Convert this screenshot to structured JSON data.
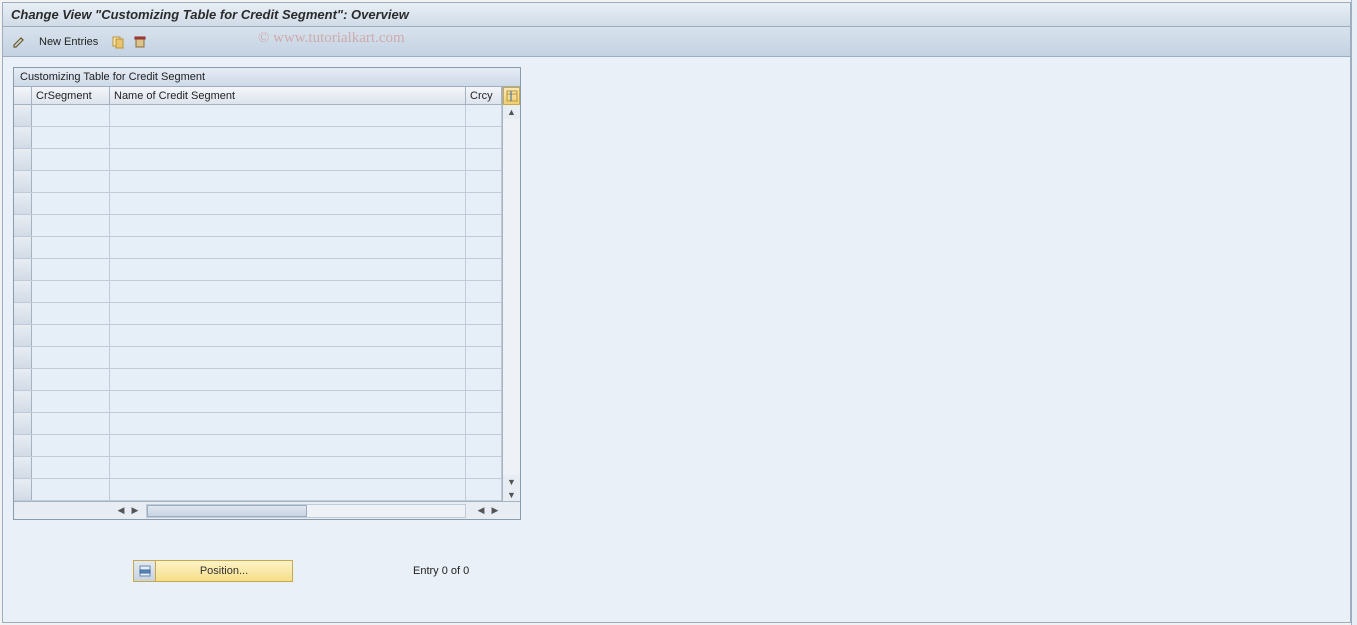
{
  "header": {
    "title": "Change View \"Customizing Table for Credit Segment\": Overview"
  },
  "toolbar": {
    "new_entries_label": "New Entries"
  },
  "watermark": "© www.tutorialkart.com",
  "table": {
    "title": "Customizing Table for Credit Segment",
    "columns": {
      "crsegment": "CrSegment",
      "name": "Name of Credit Segment",
      "crcy": "Crcy"
    },
    "rows": [
      {
        "crsegment": "",
        "name": "",
        "crcy": ""
      },
      {
        "crsegment": "",
        "name": "",
        "crcy": ""
      },
      {
        "crsegment": "",
        "name": "",
        "crcy": ""
      },
      {
        "crsegment": "",
        "name": "",
        "crcy": ""
      },
      {
        "crsegment": "",
        "name": "",
        "crcy": ""
      },
      {
        "crsegment": "",
        "name": "",
        "crcy": ""
      },
      {
        "crsegment": "",
        "name": "",
        "crcy": ""
      },
      {
        "crsegment": "",
        "name": "",
        "crcy": ""
      },
      {
        "crsegment": "",
        "name": "",
        "crcy": ""
      },
      {
        "crsegment": "",
        "name": "",
        "crcy": ""
      },
      {
        "crsegment": "",
        "name": "",
        "crcy": ""
      },
      {
        "crsegment": "",
        "name": "",
        "crcy": ""
      },
      {
        "crsegment": "",
        "name": "",
        "crcy": ""
      },
      {
        "crsegment": "",
        "name": "",
        "crcy": ""
      },
      {
        "crsegment": "",
        "name": "",
        "crcy": ""
      },
      {
        "crsegment": "",
        "name": "",
        "crcy": ""
      },
      {
        "crsegment": "",
        "name": "",
        "crcy": ""
      },
      {
        "crsegment": "",
        "name": "",
        "crcy": ""
      }
    ]
  },
  "footer": {
    "position_label": "Position...",
    "entry_status": "Entry 0 of 0"
  }
}
